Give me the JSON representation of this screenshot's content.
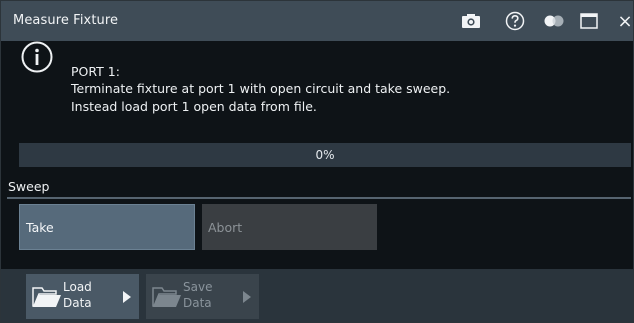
{
  "window": {
    "title": "Measure Fixture",
    "icons": [
      "camera-icon",
      "help-icon",
      "toggle-icon",
      "maximize-icon",
      "close-icon"
    ],
    "close_glyph": "×"
  },
  "message": {
    "icon": "info-icon",
    "title": "PORT 1:",
    "line1": "Terminate fixture at port 1 with open circuit and take sweep.",
    "line2": "Instead load port 1 open data from file."
  },
  "progress": {
    "text": "0%",
    "value": 0
  },
  "sweep": {
    "label": "Sweep",
    "take_label": "Take",
    "abort_label": "Abort"
  },
  "bottom": {
    "load": {
      "line1": "Load",
      "line2": "Data"
    },
    "save": {
      "line1": "Save",
      "line2": "Data"
    }
  },
  "colors": {
    "titlebar": "#3f4c57",
    "background": "#0e1317",
    "take_button": "#566a7b",
    "abort_button_disabled": "#3a3e42",
    "progress_track": "#2e3943"
  }
}
